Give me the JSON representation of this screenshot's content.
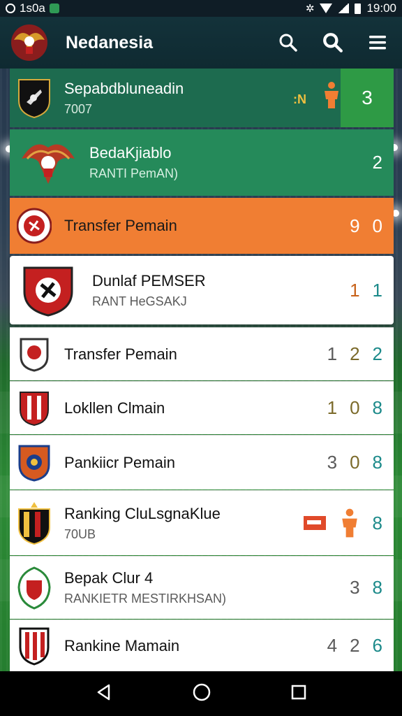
{
  "status_bar": {
    "left_text": "1s0a",
    "time": "19:00"
  },
  "app_bar": {
    "title": "Nedanesia",
    "icons": [
      "search-icon",
      "search-icon",
      "menu-icon"
    ]
  },
  "rows": [
    {
      "name": "Sepabdbluneadin",
      "sub": "7007",
      "badge": ":N",
      "nums": [
        "3"
      ]
    },
    {
      "name": "BedaKjiablo",
      "sub": "RANTI PemAN)",
      "nums": [
        "2"
      ]
    },
    {
      "name": "Transfer Pemain",
      "sub": "",
      "nums": [
        "9",
        "0"
      ]
    },
    {
      "name": "Dunlaf PEMSER",
      "sub": "RANT HeGSAKJ",
      "nums": [
        "1",
        "1"
      ]
    },
    {
      "name": "Transfer Pemain",
      "sub": "",
      "nums": [
        "1",
        "2",
        "2"
      ]
    },
    {
      "name": "Lokllen Clmain",
      "sub": "",
      "nums": [
        "1",
        "0",
        "8"
      ]
    },
    {
      "name": "Pankiicr Pemain",
      "sub": "",
      "nums": [
        "3",
        "0",
        "8"
      ]
    },
    {
      "name": "Ranking CluLsgnaKlue",
      "sub": "70UB",
      "nums": [
        "8"
      ]
    },
    {
      "name": "Bepak Clur 4",
      "sub": "RANKIETR MESTIRKHSAN)",
      "nums": [
        "3",
        "8"
      ]
    },
    {
      "name": "Rankine Mamain",
      "sub": "",
      "nums": [
        "4",
        "2",
        "6"
      ]
    }
  ],
  "colors": {
    "row_dark_green": "#1d6b4f",
    "row_green": "#258a5a",
    "row_orange": "#f07e33",
    "accent_teal": "#1c8a8a"
  }
}
